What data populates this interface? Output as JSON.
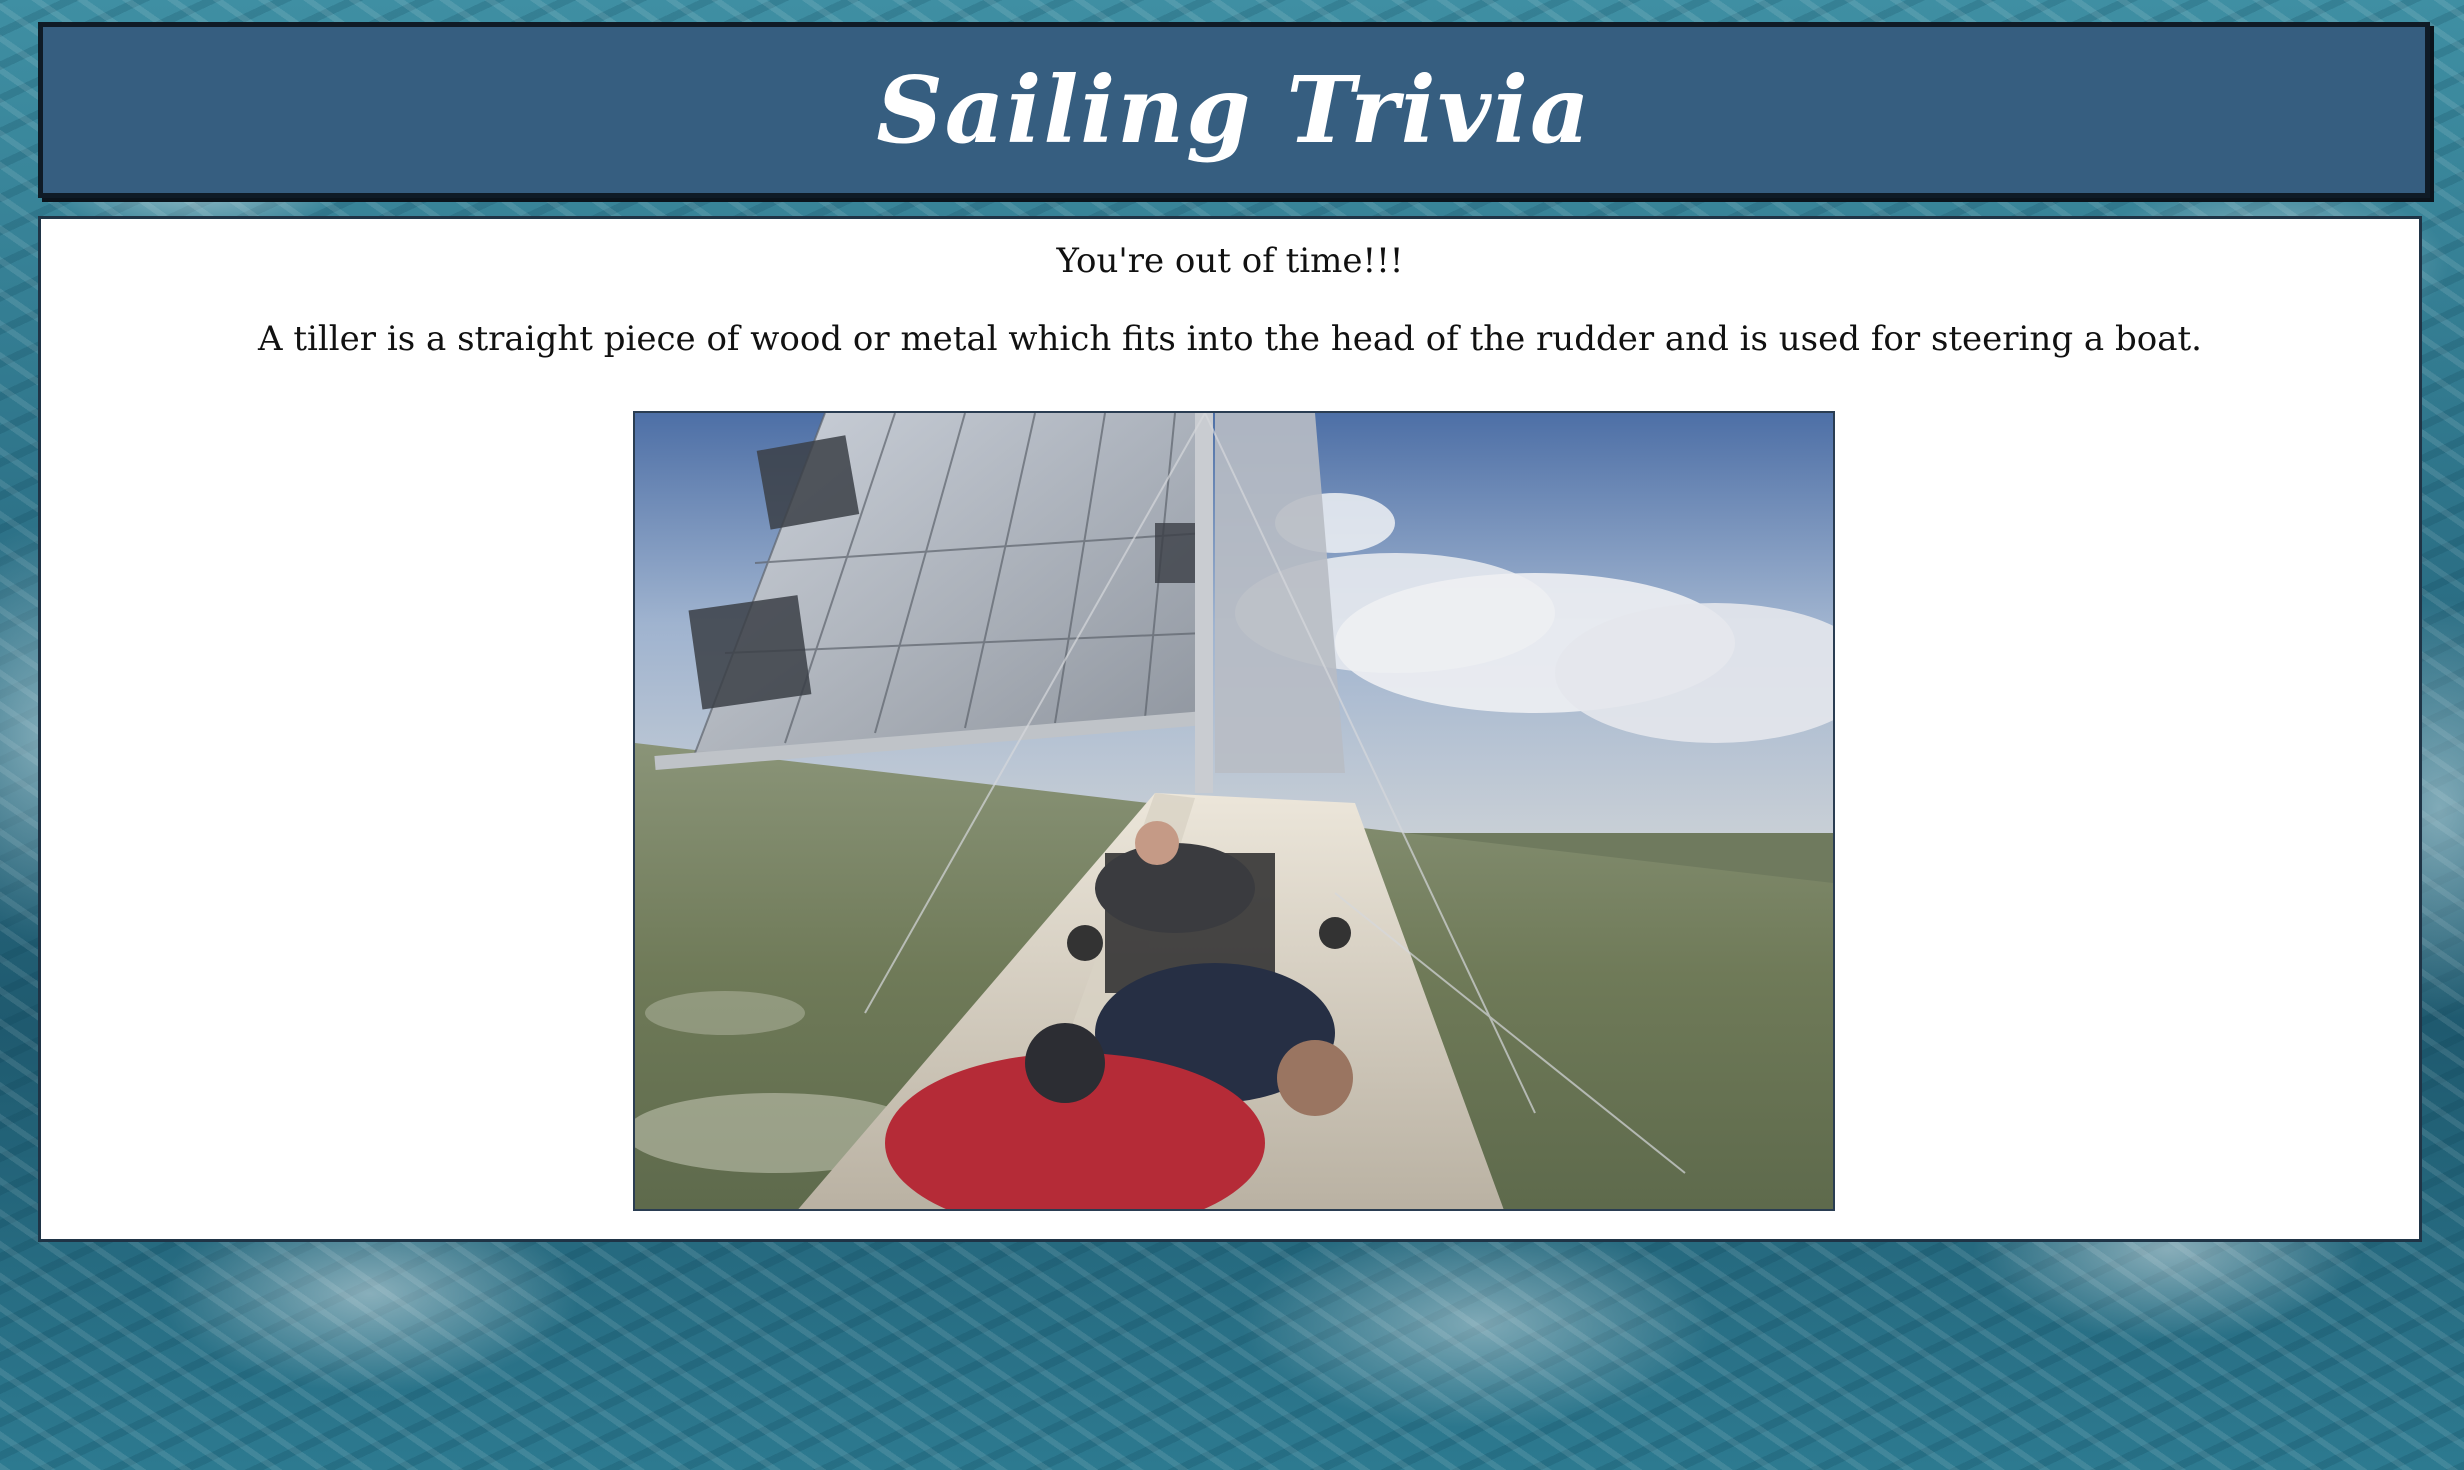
{
  "header": {
    "title": "Sailing Trivia"
  },
  "panel": {
    "status_text": "You're out of time!!!",
    "answer_text": "A tiller is a straight piece of wood or metal which fits into the head of the rudder and is used for steering a boat."
  },
  "media": {
    "image_alt": "sailboat-gif"
  },
  "colors": {
    "header_bg": "#365e80",
    "panel_bg": "#ffffff",
    "border": "#1f3446"
  }
}
